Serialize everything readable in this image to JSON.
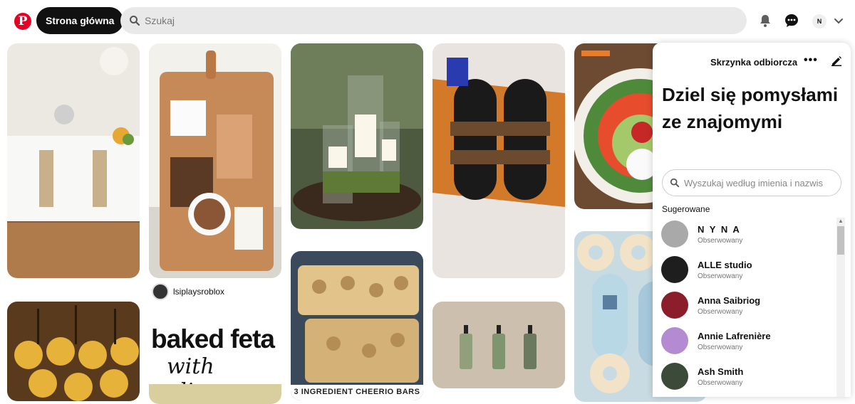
{
  "header": {
    "logo_letter": "P",
    "home_label": "Strona główna",
    "search_placeholder": "Szukaj",
    "avatar_initial": "N"
  },
  "pins": [
    {
      "name": "pin-wedding-table",
      "colors": [
        "#d9c9b0",
        "#f2f0ec",
        "#b07b4a"
      ]
    },
    {
      "name": "pin-smores-board",
      "colors": [
        "#c58a57",
        "#f1efe8",
        "#5b3a25"
      ],
      "owner": "lsiplaysroblox"
    },
    {
      "name": "pin-candle-jars",
      "colors": [
        "#3e4a35",
        "#6b7a58",
        "#2a2a28"
      ]
    },
    {
      "name": "pin-lv-sandals",
      "colors": [
        "#e9e4df",
        "#d27a2a",
        "#1a1a1a"
      ]
    },
    {
      "name": "pin-veggie-turkey",
      "colors": [
        "#6d4a32",
        "#4f8a3b",
        "#e74c2d"
      ]
    },
    {
      "name": "pin-pineapple-bites",
      "colors": [
        "#5a3a1d",
        "#e6b23a",
        "#2a1a0a"
      ]
    },
    {
      "name": "pin-baked-feta",
      "title_line1": "baked feta",
      "title_line2": "with olives"
    },
    {
      "name": "pin-cheerio-bars",
      "caption": "3 INGREDIENT CHEERIO BARS",
      "colors": [
        "#b48d55",
        "#e2c48a",
        "#7a5a30"
      ]
    },
    {
      "name": "pin-soap-bottles",
      "colors": [
        "#cdbfae",
        "#8fa07a",
        "#6b7a5e"
      ]
    },
    {
      "name": "pin-blue-donuts",
      "colors": [
        "#b9d8e6",
        "#f2e2c7",
        "#5a7ea0"
      ]
    }
  ],
  "panel": {
    "title": "Skrzynka odbiorcza",
    "heading": "Dziel się pomysłami ze znajomymi",
    "search_placeholder": "Wyszukaj według imienia i nazwis",
    "suggested_label": "Sugerowane",
    "users": [
      {
        "name": "N Y N A",
        "status": "Obserwowany",
        "avatar_color": "#a9a9a9"
      },
      {
        "name": "ALLE studio",
        "status": "Obserwowany",
        "avatar_color": "#1e1e1e"
      },
      {
        "name": "Anna Saibriog",
        "status": "Obserwowany",
        "avatar_color": "#8b1e2a"
      },
      {
        "name": "Annie Lafrenière",
        "status": "Obserwowany",
        "avatar_color": "#b48ad2"
      },
      {
        "name": "Ash Smith",
        "status": "Obserwowany",
        "avatar_color": "#3c4a3a"
      }
    ]
  }
}
